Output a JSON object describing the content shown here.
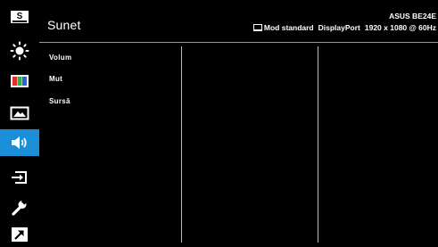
{
  "header": {
    "title": "Sunet",
    "model": "ASUS BE24E",
    "mode": "Mod standard",
    "input": "DisplayPort",
    "resolution": "1920 x 1080 @ 60Hz"
  },
  "sidebar": {
    "items": [
      {
        "icon": "splendid-icon",
        "label": "S"
      },
      {
        "icon": "brightness-icon"
      },
      {
        "icon": "color-icon"
      },
      {
        "icon": "image-icon"
      },
      {
        "icon": "sound-icon",
        "active": true
      },
      {
        "icon": "input-select-icon"
      },
      {
        "icon": "system-setup-icon"
      },
      {
        "icon": "shortcut-icon"
      }
    ],
    "active_color": "#1a8fd8"
  },
  "menu": {
    "items": [
      {
        "label": "Volum"
      },
      {
        "label": "Mut"
      },
      {
        "label": "Sursă"
      }
    ]
  }
}
